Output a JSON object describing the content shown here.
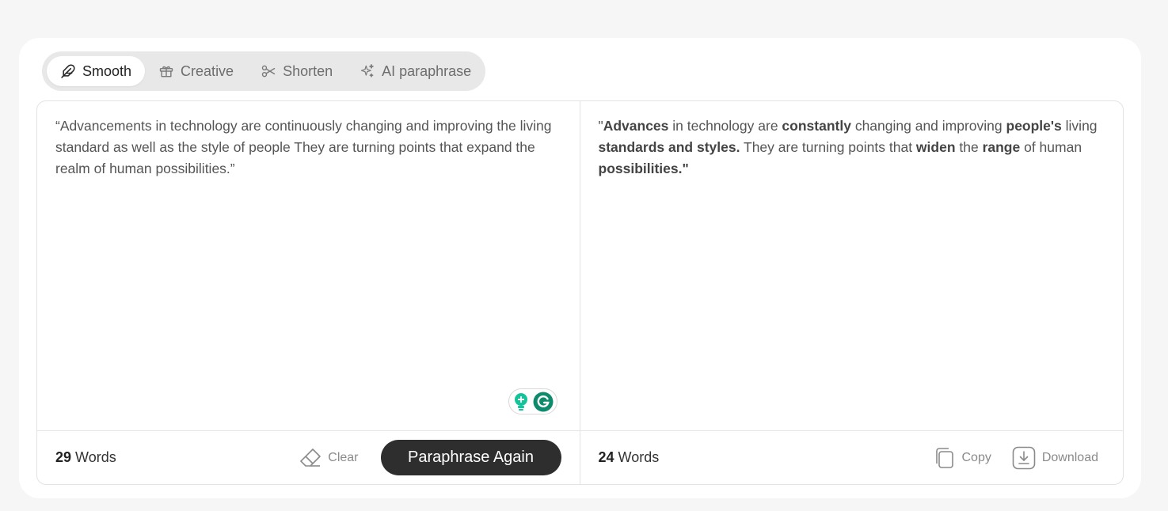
{
  "modes": [
    {
      "label": "Smooth",
      "icon": "feather-icon",
      "active": true
    },
    {
      "label": "Creative",
      "icon": "gift-icon",
      "active": false
    },
    {
      "label": "Shorten",
      "icon": "scissors-icon",
      "active": false
    },
    {
      "label": "AI paraphrase",
      "icon": "sparkles-icon",
      "active": false
    }
  ],
  "input": {
    "text": "“Advancements in technology are continuously changing and improving the living standard as well as the style of people They are turning points that expand the realm of human possibilities.”",
    "word_count": "29",
    "words_label": "Words",
    "clear_label": "Clear",
    "paraphrase_label": "Paraphrase Again"
  },
  "output": {
    "segments": [
      {
        "text": "\"",
        "bold": false
      },
      {
        "text": "Advances",
        "bold": true
      },
      {
        "text": " in technology are ",
        "bold": false
      },
      {
        "text": "constantly",
        "bold": true
      },
      {
        "text": " changing and improving ",
        "bold": false
      },
      {
        "text": "people's",
        "bold": true
      },
      {
        "text": " living ",
        "bold": false
      },
      {
        "text": "standards and styles.",
        "bold": true
      },
      {
        "text": " They are turning points that ",
        "bold": false
      },
      {
        "text": "widen",
        "bold": true
      },
      {
        "text": " the ",
        "bold": false
      },
      {
        "text": "range",
        "bold": true
      },
      {
        "text": " of human ",
        "bold": false
      },
      {
        "text": "possibilities.\"",
        "bold": true
      }
    ],
    "word_count": "24",
    "words_label": "Words",
    "copy_label": "Copy",
    "download_label": "Download"
  },
  "colors": {
    "primary_button": "#2e2e2e",
    "grammarly_green": "#15c39a",
    "grammarly_dark": "#0e8a6c"
  }
}
